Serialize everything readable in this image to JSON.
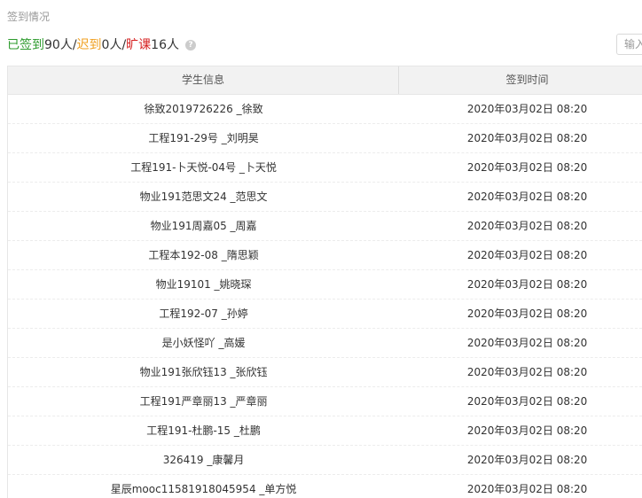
{
  "section": {
    "title": "签到情况"
  },
  "stats": {
    "signed_label": "已签到",
    "signed_count": "90人/",
    "late_label": "迟到",
    "late_count": "0人/",
    "absent_label": "旷课",
    "absent_count": "16人",
    "help_icon": "?"
  },
  "search": {
    "placeholder": "输入"
  },
  "table": {
    "headers": [
      "学生信息",
      "签到时间"
    ],
    "rows": [
      {
        "student": "徐致2019726226 _徐致",
        "time": "2020年03月02日 08:20"
      },
      {
        "student": "工程191-29号 _刘明昊",
        "time": "2020年03月02日 08:20"
      },
      {
        "student": "工程191-卜天悦-04号 _卜天悦",
        "time": "2020年03月02日 08:20"
      },
      {
        "student": "物业191范思文24 _范思文",
        "time": "2020年03月02日 08:20"
      },
      {
        "student": "物业191周嘉05 _周嘉",
        "time": "2020年03月02日 08:20"
      },
      {
        "student": "工程本192-08 _隋思颖",
        "time": "2020年03月02日 08:20"
      },
      {
        "student": "物业19101 _姚晓琛",
        "time": "2020年03月02日 08:20"
      },
      {
        "student": "工程192-07 _孙婷",
        "time": "2020年03月02日 08:20"
      },
      {
        "student": "是小妖怪吖 _高媛",
        "time": "2020年03月02日 08:20"
      },
      {
        "student": "物业191张欣钰13 _张欣钰",
        "time": "2020年03月02日 08:20"
      },
      {
        "student": "工程191严章丽13 _严章丽",
        "time": "2020年03月02日 08:20"
      },
      {
        "student": "工程191-杜鹏-15 _杜鹏",
        "time": "2020年03月02日 08:20"
      },
      {
        "student": "326419 _康馨月",
        "time": "2020年03月02日 08:20"
      },
      {
        "student": "星辰mooc11581918045954 _单方悦",
        "time": "2020年03月02日 08:20"
      }
    ]
  }
}
